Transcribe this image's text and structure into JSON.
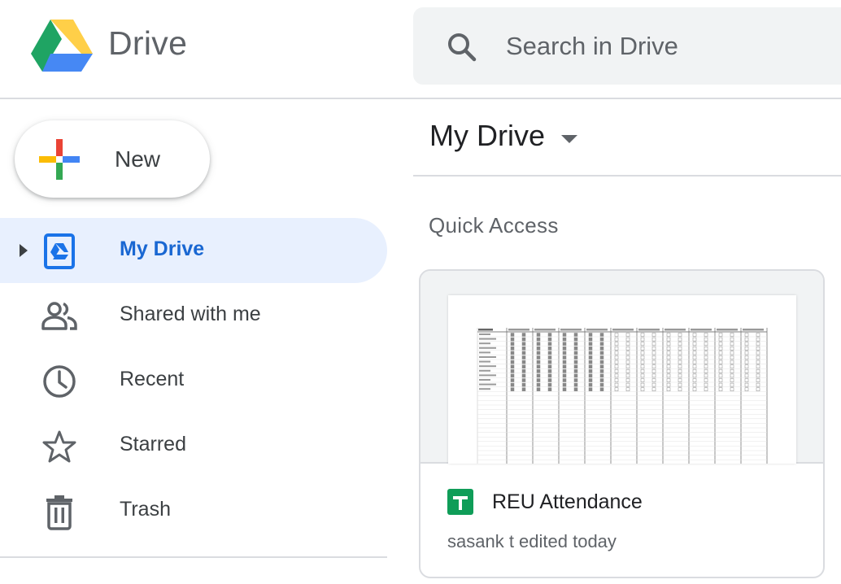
{
  "header": {
    "brand": "Drive",
    "logo_icon": "google-drive-logo-icon",
    "search": {
      "placeholder": "Search in Drive",
      "value": "",
      "icon": "search-icon"
    }
  },
  "new_button": {
    "label": "New",
    "icon": "colorful-plus-icon"
  },
  "sidebar": {
    "items": [
      {
        "label": "My Drive",
        "icon": "my-drive-icon",
        "active": true,
        "expandable": true
      },
      {
        "label": "Shared with me",
        "icon": "people-icon",
        "active": false
      },
      {
        "label": "Recent",
        "icon": "clock-icon",
        "active": false
      },
      {
        "label": "Starred",
        "icon": "star-icon",
        "active": false
      },
      {
        "label": "Trash",
        "icon": "trash-icon",
        "active": false
      }
    ]
  },
  "main": {
    "title": "My Drive",
    "title_dropdown_icon": "caret-down-icon",
    "quick_access": {
      "heading": "Quick Access",
      "files": [
        {
          "name": "REU Attendance",
          "type_icon": "google-sheets-icon",
          "meta": "sasank t edited today"
        }
      ]
    }
  },
  "colors": {
    "active_nav_bg": "#e8f0fe",
    "active_nav_text": "#1967d2",
    "search_bg": "#f1f3f4",
    "sheets_green": "#0f9d58",
    "divider": "#dadce0"
  }
}
